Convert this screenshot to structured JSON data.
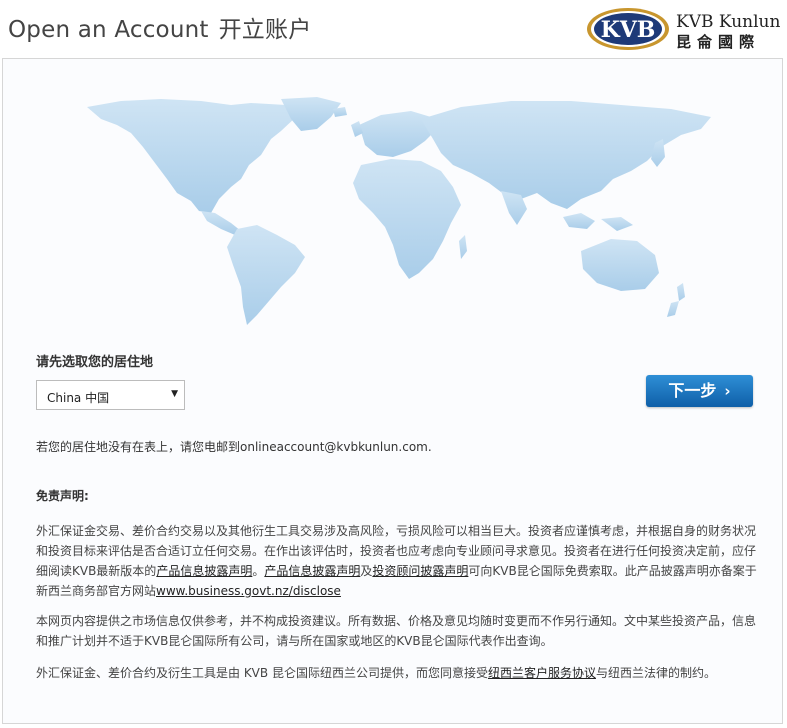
{
  "header": {
    "title_en": "Open an Account",
    "title_cn": "开立账户",
    "logo_emblem_text": "KVB",
    "logo_en": "KVB Kunlun",
    "logo_cn": "昆侖國際"
  },
  "form": {
    "residence_label": "请先选取您的居住地",
    "country_selected": "China 中国",
    "next_label": "下一步",
    "not_listed_note": "若您的居住地没有在表上，请您电邮到onlineaccount@kvbkunlun.com."
  },
  "disclaimer": {
    "title": "免责声明:",
    "p1_a": "外汇保证金交易、差价合约交易以及其他衍生工具交易涉及高风险，亏损风险可以相当巨大。投资者应谨慎考虑，并根据自身的财务状况和投资目标来评估是否合适订立任何交易。在作出该评估时，投资者也应考虑向专业顾问寻求意见。投资者在进行任何投资决定前，应仔细阅读KVB最新版本的",
    "link_product1": "产品信息披露声明",
    "p1_b": "。",
    "link_product2": "产品信息披露声明",
    "p1_c": "及",
    "link_advisor": "投资顾问披露声明",
    "p1_d": "可向KVB昆仑国际免费索取。此产品披露声明亦备案于新西兰商务部官方网站",
    "link_business": "www.business.govt.nz/disclose",
    "p2": "本网页内容提供之市场信息仅供参考，并不构成投资建议。所有数据、价格及意见均随时变更而不作另行通知。文中某些投资产品，信息和推广计划并不适于KVB昆仑国际所有公司，请与所在国家或地区的KVB昆仑国际代表作出查询。",
    "p3_a": "外汇保证金、差价合约及衍生工具是由 KVB 昆仑国际纽西兰公司提供，而您同意接受",
    "link_nz_agreement": "纽西兰客户服务协议",
    "p3_b": "与纽西兰法律的制约。"
  },
  "colors": {
    "map": "#bcd9ef",
    "button_top": "#2f8fd6",
    "button_bottom": "#0f5fa8",
    "logo_navy": "#1e3a78",
    "logo_gold": "#c8962e"
  }
}
